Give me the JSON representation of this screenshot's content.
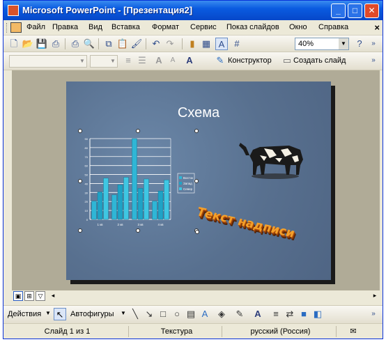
{
  "window": {
    "title": "Microsoft PowerPoint - [Презентация2]"
  },
  "menu": [
    "Файл",
    "Правка",
    "Вид",
    "Вставка",
    "Формат",
    "Сервис",
    "Показ слайдов",
    "Окно",
    "Справка"
  ],
  "toolbar": {
    "zoom": "40%",
    "designer_label": "Конструктор",
    "new_slide_label": "Создать слайд"
  },
  "slide": {
    "title": "Схема",
    "wordart_text": "Текст надписи",
    "chart_data": {
      "type": "bar",
      "categories": [
        "1 кв",
        "2 кв",
        "3 кв",
        "4 кв"
      ],
      "series": [
        {
          "name": "Восток",
          "values": [
            20.4,
            27.4,
            90,
            20.4
          ]
        },
        {
          "name": "Запад",
          "values": [
            30.6,
            38.6,
            34.6,
            31.6
          ]
        },
        {
          "name": "Север",
          "values": [
            45.9,
            46.9,
            45,
            43.9
          ]
        }
      ],
      "ylim": [
        0,
        90
      ],
      "yticks": [
        "0",
        "10",
        "20",
        "30",
        "40",
        "50",
        "60",
        "70",
        "80",
        "90"
      ],
      "grid": true,
      "legend": "right"
    }
  },
  "drawbar": {
    "actions_label": "Действия",
    "autoshapes_label": "Автофигуры"
  },
  "status": {
    "slide": "Слайд 1 из 1",
    "design": "Текстура",
    "language": "русский (Россия)"
  },
  "colors": {
    "bar_series_1": "#2fb6d6",
    "bar_series_2": "#1fa3c6",
    "bar_series_3": "#3fc7e3",
    "slide_bg": "#5a7391"
  }
}
